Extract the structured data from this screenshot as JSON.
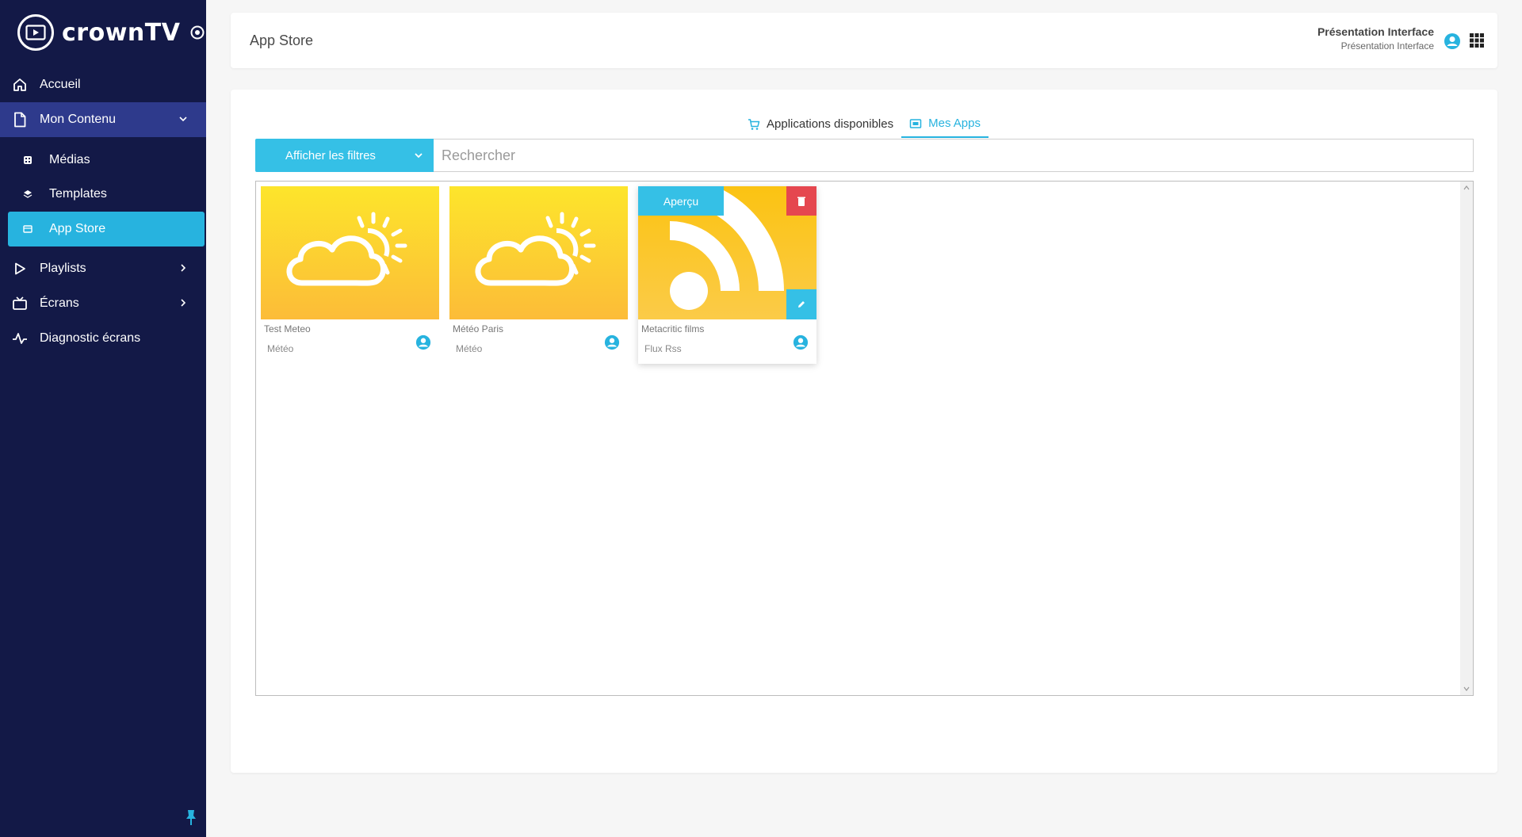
{
  "brand": {
    "name": "crownTV",
    "accent": "#27b3df",
    "sidebar_bg": "#131947"
  },
  "sidebar": {
    "items": [
      {
        "label": "Accueil",
        "icon": "home-icon"
      },
      {
        "label": "Mon Contenu",
        "icon": "document-icon",
        "expanded": true
      },
      {
        "label": "Médias",
        "icon": "media-icon",
        "sub": true
      },
      {
        "label": "Templates",
        "icon": "layers-icon",
        "sub": true
      },
      {
        "label": "App Store",
        "icon": "store-icon",
        "sub": true,
        "active": true
      },
      {
        "label": "Playlists",
        "icon": "play-icon"
      },
      {
        "label": "Écrans",
        "icon": "tv-icon"
      },
      {
        "label": "Diagnostic écrans",
        "icon": "pulse-icon"
      }
    ]
  },
  "header": {
    "title": "App Store",
    "user_name": "Présentation Interface",
    "user_sub": "Présentation Interface"
  },
  "tabs": [
    {
      "label": "Applications disponibles",
      "icon": "cart-icon",
      "active": false
    },
    {
      "label": "Mes Apps",
      "icon": "apps-icon",
      "active": true
    }
  ],
  "filters": {
    "button_label": "Afficher les filtres",
    "search_placeholder": "Rechercher"
  },
  "apps": [
    {
      "name": "Test Meteo",
      "category": "Météo",
      "thumbnail": "weather-icon"
    },
    {
      "name": "Météo Paris",
      "category": "Météo",
      "thumbnail": "weather-icon"
    },
    {
      "name": "Metacritic films",
      "category": "Flux Rss",
      "thumbnail": "rss-icon",
      "hovered": true
    }
  ],
  "card_actions": {
    "preview_label": "Aperçu"
  }
}
